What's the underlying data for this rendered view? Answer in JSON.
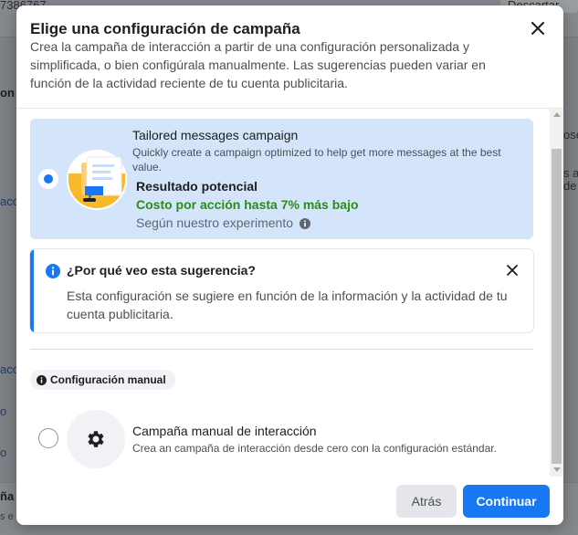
{
  "background": {
    "top_left_text": "7386767",
    "top_right_button": "Descartar",
    "left_texts": [
      "on",
      "acci",
      "acci",
      "o",
      "o",
      "ña",
      "s e"
    ],
    "right_texts": [
      "ose",
      "s a",
      "de"
    ]
  },
  "modal": {
    "title": "Elige una configuración de campaña",
    "description": "Crea la campaña de interacción a partir de una configuración personalizada y simplificada, o bien configúrala manualmente. Las sugerencias pueden variar en función de la actividad reciente de tu cuenta publicitaria.",
    "close_icon": "close-icon"
  },
  "tailored": {
    "title": "Tailored messages campaign",
    "description": "Quickly create a campaign optimized to help get more messages at the best value.",
    "result_label": "Resultado potencial",
    "result_value": "Costo por acción hasta 7% más bajo",
    "result_note": "Según nuestro experimento",
    "selected": true
  },
  "why": {
    "title": "¿Por qué veo esta sugerencia?",
    "text": "Esta configuración se sugiere en función de la información y la actividad de tu cuenta publicitaria."
  },
  "manual": {
    "pill_label": "Configuración manual",
    "title": "Campaña manual de interacción",
    "description": "Crea an campaña de interacción desde cero con la configuración estándar.",
    "selected": false
  },
  "footer": {
    "back_label": "Atrás",
    "continue_label": "Continuar"
  },
  "colors": {
    "accent": "#1877f2",
    "selected_card": "#d4e4fb",
    "positive": "#2c8b1b"
  }
}
